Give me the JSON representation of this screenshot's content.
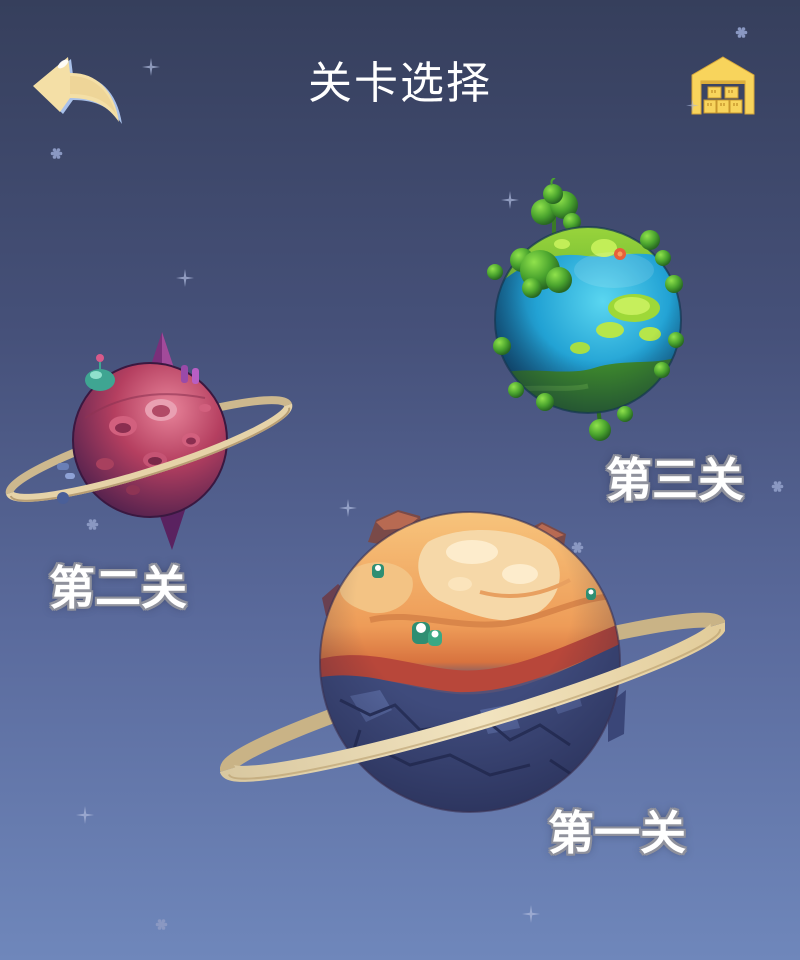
{
  "header": {
    "title": "关卡选择",
    "back_icon": "back-arrow-icon",
    "store_icon": "warehouse-icon"
  },
  "levels": [
    {
      "label": "第一关",
      "icon": "orange-ringed-planet-icon"
    },
    {
      "label": "第二关",
      "icon": "crimson-ringed-planet-icon"
    },
    {
      "label": "第三关",
      "icon": "green-ocean-planet-icon"
    }
  ],
  "decor": {
    "icons": [
      "sparkle-icon",
      "star-dot-icon"
    ]
  },
  "colors": {
    "background_top": "#363f5c",
    "background_bottom": "#6f87bb",
    "text": "#ffffff",
    "label_outline": "#8f919c",
    "back_arrow": "#f4dfa6",
    "store_icon": "#f8d45c"
  }
}
